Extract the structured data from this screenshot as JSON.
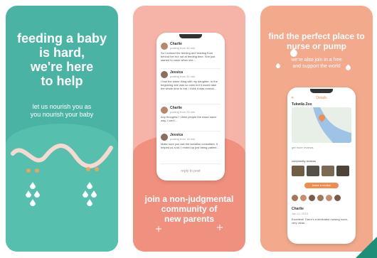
{
  "card1": {
    "headline_lines": [
      "feeding a baby",
      "is hard,",
      "we're here",
      "to help"
    ],
    "subtext_lines": [
      "let us nourish you as",
      "you nourish your baby"
    ]
  },
  "card2": {
    "headline_lines": [
      "join a non-judgmental",
      "community of",
      "new parents"
    ],
    "posts": [
      {
        "name": "Charlie",
        "time": "posting from 46 min",
        "body": "So i noticed the feeding and reading from behind her but not at feeding time. She just started to crack when she..."
      },
      {
        "name": "Jessica",
        "time": "posting from 31 min",
        "body": "I had the same thing with my daughter. In the beginning she was so calm but it would take the whole time to eat. I think it was normal..."
      },
      {
        "name": "Charlie",
        "time": "posting from 28 min",
        "body": "Any thoughts? i think people the exact same way, I can't..."
      },
      {
        "name": "Jessica",
        "time": "posting from 18 min",
        "body": "Make sure you ask the lactation consultant, it helped us a lot. I ended up just being patient..."
      }
    ],
    "footer": "reply to post"
  },
  "card3": {
    "headline_lines": [
      "find the perfect place to",
      "nurse or pump"
    ],
    "subtext_lines": [
      "we're also join in a free",
      "and support the world"
    ],
    "app_title": "Details",
    "place_title": "Tukwila Zoo",
    "rating_label": "get more reviews",
    "gallery_label": "community reviews",
    "button_label": "leave a review",
    "reviewer": "Charlie",
    "review_time": "Jan 11, 2019",
    "review_body": "Excellent! There's a dedicated nursing room, very clean..."
  },
  "colors": {
    "teal": "#4bb3a3",
    "pink": "#f6b4a8",
    "coral": "#f3a98b",
    "accent": "#ef8c4e"
  }
}
